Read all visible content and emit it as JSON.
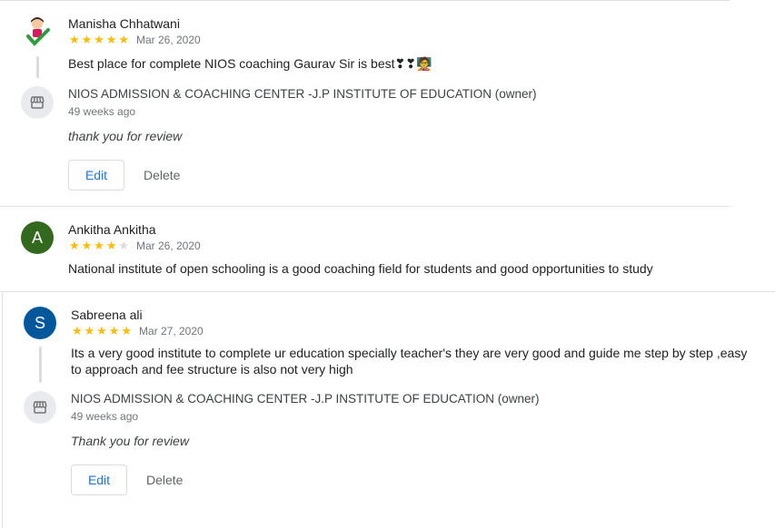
{
  "reviews": [
    {
      "name": "Manisha Chhatwani",
      "stars": 5,
      "date": "Mar 26, 2020",
      "text": "Best place for complete NIOS coaching Gaurav Sir is best❣❣🧑‍🏫",
      "owner_response": {
        "owner_name": "NIOS ADMISSION & COACHING CENTER -J.P INSTITUTE OF EDUCATION (owner)",
        "time_ago": "49 weeks ago",
        "reply": "thank you for review",
        "edit_label": "Edit",
        "delete_label": "Delete"
      }
    },
    {
      "name": "Ankitha Ankitha",
      "avatar_letter": "A",
      "avatar_color": "#33691e",
      "stars": 4,
      "date": "Mar 26, 2020",
      "text": "National institute of open schooling is a good coaching field for students and good opportunities to study"
    },
    {
      "name": "Sabreena ali",
      "avatar_letter": "S",
      "avatar_color": "#01579b",
      "stars": 5,
      "date": "Mar 27, 2020",
      "text": "Its a very good institute to complete ur education specially teacher's they are very good and guide me step by step ,easy to approach and fee structure is also not very high",
      "owner_response": {
        "owner_name": "NIOS ADMISSION & COACHING CENTER -J.P INSTITUTE OF EDUCATION (owner)",
        "time_ago": "49 weeks ago",
        "reply": "Thank you for review",
        "edit_label": "Edit",
        "delete_label": "Delete"
      }
    }
  ],
  "colors": {
    "star": "#fbbc04",
    "link_blue": "#1a73e8"
  }
}
